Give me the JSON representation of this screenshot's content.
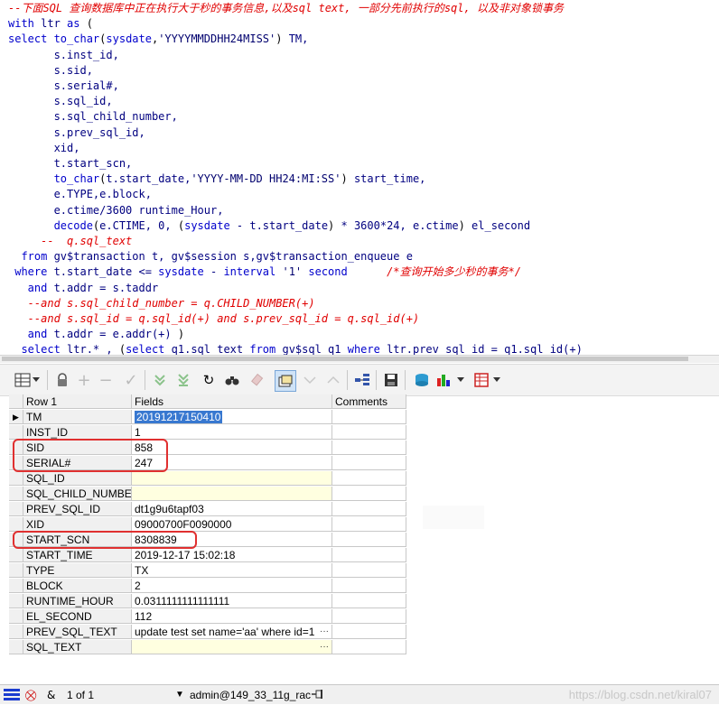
{
  "editor": {
    "lines": [
      [
        {
          "c": "cm",
          "t": "--下面SQL 查询数据库中正在执行大于秒的事务信息,以及sql text, 一部分先前执行的sql, 以及非对象锁事务"
        }
      ],
      [
        {
          "c": "kw",
          "t": "with "
        },
        {
          "c": "tx",
          "t": "ltr "
        },
        {
          "c": "kw",
          "t": "as "
        },
        {
          "c": "op",
          "t": "("
        }
      ],
      [
        {
          "c": "kw",
          "t": "select "
        },
        {
          "c": "fn",
          "t": "to_char"
        },
        {
          "c": "op",
          "t": "("
        },
        {
          "c": "fn",
          "t": "sysdate"
        },
        {
          "c": "op",
          "t": ","
        },
        {
          "c": "st",
          "t": "'YYYYMMDDHH24MISS'"
        },
        {
          "c": "op",
          "t": ") "
        },
        {
          "c": "tx",
          "t": "TM,"
        }
      ],
      [
        {
          "c": "tx",
          "t": "       s.inst_id,"
        }
      ],
      [
        {
          "c": "tx",
          "t": "       s.sid,"
        }
      ],
      [
        {
          "c": "tx",
          "t": "       s.serial#,"
        }
      ],
      [
        {
          "c": "tx",
          "t": "       s.sql_id,"
        }
      ],
      [
        {
          "c": "tx",
          "t": "       s.sql_child_number,"
        }
      ],
      [
        {
          "c": "tx",
          "t": "       s.prev_sql_id,"
        }
      ],
      [
        {
          "c": "tx",
          "t": "       xid,"
        }
      ],
      [
        {
          "c": "tx",
          "t": "       t.start_scn,"
        }
      ],
      [
        {
          "c": "fn",
          "t": "       to_char"
        },
        {
          "c": "op",
          "t": "("
        },
        {
          "c": "tx",
          "t": "t.start_date,"
        },
        {
          "c": "st",
          "t": "'YYYY-MM-DD HH24:MI:SS'"
        },
        {
          "c": "op",
          "t": ") "
        },
        {
          "c": "tx",
          "t": "start_time,"
        }
      ],
      [
        {
          "c": "tx",
          "t": "       e.TYPE,e.block,"
        }
      ],
      [
        {
          "c": "tx",
          "t": "       e.ctime/3600 runtime_Hour,"
        }
      ],
      [
        {
          "c": "fn",
          "t": "       decode"
        },
        {
          "c": "op",
          "t": "("
        },
        {
          "c": "tx",
          "t": "e.CTIME, 0, "
        },
        {
          "c": "op",
          "t": "("
        },
        {
          "c": "fn",
          "t": "sysdate"
        },
        {
          "c": "tx",
          "t": " - t.start_date"
        },
        {
          "c": "op",
          "t": ")"
        },
        {
          "c": "tx",
          "t": " * 3600*24, e.ctime"
        },
        {
          "c": "op",
          "t": ")"
        },
        {
          "c": "tx",
          "t": " el_second"
        }
      ],
      [
        {
          "c": "cm",
          "t": "     --  q.sql_text"
        }
      ],
      [
        {
          "c": "kw",
          "t": "  from "
        },
        {
          "c": "tx",
          "t": "gv$transaction t, gv$session s,gv$transaction_enqueue e"
        }
      ],
      [
        {
          "c": "kw",
          "t": " where "
        },
        {
          "c": "tx",
          "t": "t.start_date <= "
        },
        {
          "c": "fn",
          "t": "sysdate"
        },
        {
          "c": "tx",
          "t": " - "
        },
        {
          "c": "kw",
          "t": "interval "
        },
        {
          "c": "st",
          "t": "'1' "
        },
        {
          "c": "kw",
          "t": "second"
        },
        {
          "c": "cm",
          "t": "      /*查询开始多少秒的事务*/"
        }
      ],
      [
        {
          "c": "kw",
          "t": "   and "
        },
        {
          "c": "tx",
          "t": "t.addr = s.taddr"
        }
      ],
      [
        {
          "c": "cm",
          "t": "   --and s.sql_child_number = q.CHILD_NUMBER(+)"
        }
      ],
      [
        {
          "c": "cm",
          "t": "   --and s.sql_id = q.sql_id(+) and s.prev_sql_id = q.sql_id(+)"
        }
      ],
      [
        {
          "c": "kw",
          "t": "   and "
        },
        {
          "c": "tx",
          "t": "t.addr = e.addr(+) "
        },
        {
          "c": "op",
          "t": ")"
        }
      ],
      [
        {
          "c": "kw",
          "t": "  select "
        },
        {
          "c": "tx",
          "t": "ltr.* , "
        },
        {
          "c": "op",
          "t": "("
        },
        {
          "c": "kw",
          "t": "select "
        },
        {
          "c": "tx",
          "t": "q1.sql_text "
        },
        {
          "c": "kw",
          "t": "from "
        },
        {
          "c": "tx",
          "t": "gv$sql q1 "
        },
        {
          "c": "kw",
          "t": "where "
        },
        {
          "c": "tx",
          "t": "ltr.prev_sql_id = q1.sql_id(+)"
        }
      ]
    ]
  },
  "toolbar": {
    "icons": [
      "grid-view-icon",
      "dropdown-arrow-icon",
      "lock-icon",
      "add-record-icon",
      "delete-record-icon",
      "post-icon",
      "fetch-next-icon",
      "fetch-last-icon",
      "refresh-icon",
      "find-icon",
      "clear-icon",
      "single-record-view-icon",
      "sort-icon",
      "sort-up-icon",
      "connect-icon",
      "save-icon",
      "export-icon",
      "chart-icon",
      "table-icon"
    ]
  },
  "grid": {
    "headers": {
      "row": "Row 1",
      "fields": "Fields",
      "comments": "Comments"
    },
    "rows": [
      {
        "name": "TM",
        "value": "20191217150410",
        "current": true,
        "selected": true
      },
      {
        "name": "INST_ID",
        "value": "1"
      },
      {
        "name": "SID",
        "value": "858"
      },
      {
        "name": "SERIAL#",
        "value": "247"
      },
      {
        "name": "SQL_ID",
        "value": "",
        "yellow": true
      },
      {
        "name": "SQL_CHILD_NUMBER",
        "value": "",
        "yellow": true
      },
      {
        "name": "PREV_SQL_ID",
        "value": "dt1g9u6tapf03"
      },
      {
        "name": "XID",
        "value": "09000700F0090000"
      },
      {
        "name": "START_SCN",
        "value": "8308839"
      },
      {
        "name": "START_TIME",
        "value": "2019-12-17 15:02:18"
      },
      {
        "name": "TYPE",
        "value": "TX"
      },
      {
        "name": "BLOCK",
        "value": "2"
      },
      {
        "name": "RUNTIME_HOUR",
        "value": "0.0311111111111111"
      },
      {
        "name": "EL_SECOND",
        "value": "112"
      },
      {
        "name": "PREV_SQL_TEXT",
        "value": "update test set name='aa' where id=1",
        "ellipsis": true
      },
      {
        "name": "SQL_TEXT",
        "value": "",
        "yellow": true,
        "ellipsis": true
      }
    ],
    "ellipsis_glyph": "···",
    "indicator_glyph": "▶"
  },
  "status": {
    "record_label": "1 of 1",
    "connection": "admin@149_33_11g_rac",
    "watermark": "https://blog.csdn.net/kiral07"
  },
  "colors": {
    "highlight_box": "#e03030",
    "selection": "#3878d0",
    "empty_cell": "#ffffe0"
  }
}
